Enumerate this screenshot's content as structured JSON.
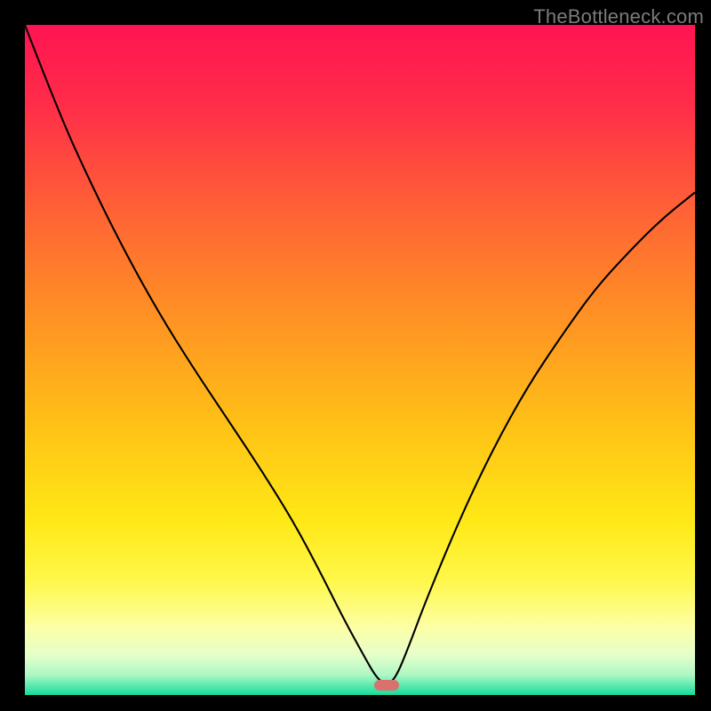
{
  "watermark": "TheBottleneck.com",
  "marker": {
    "x_frac": 0.54,
    "y_frac": 0.985,
    "color": "#d9716f"
  },
  "gradient_stops": [
    {
      "offset": 0.0,
      "color": "#ff1452"
    },
    {
      "offset": 0.12,
      "color": "#ff2d49"
    },
    {
      "offset": 0.28,
      "color": "#ff6335"
    },
    {
      "offset": 0.44,
      "color": "#ff9323"
    },
    {
      "offset": 0.6,
      "color": "#ffc216"
    },
    {
      "offset": 0.74,
      "color": "#ffe816"
    },
    {
      "offset": 0.83,
      "color": "#fff84b"
    },
    {
      "offset": 0.9,
      "color": "#fcffa6"
    },
    {
      "offset": 0.94,
      "color": "#e6ffc9"
    },
    {
      "offset": 0.97,
      "color": "#aef7c4"
    },
    {
      "offset": 0.985,
      "color": "#5feab0"
    },
    {
      "offset": 1.0,
      "color": "#15dc9b"
    }
  ],
  "chart_data": {
    "type": "line",
    "title": "",
    "xlabel": "",
    "ylabel": "",
    "xlim": [
      0,
      1
    ],
    "ylim": [
      0,
      1
    ],
    "grid": false,
    "legend": false,
    "series": [
      {
        "name": "curve",
        "color": "#000000",
        "x": [
          0.0,
          0.05,
          0.1,
          0.15,
          0.2,
          0.25,
          0.3,
          0.35,
          0.4,
          0.44,
          0.475,
          0.505,
          0.525,
          0.54,
          0.553,
          0.57,
          0.6,
          0.65,
          0.7,
          0.75,
          0.8,
          0.85,
          0.9,
          0.95,
          1.0
        ],
        "y": [
          1.0,
          0.87,
          0.76,
          0.66,
          0.57,
          0.49,
          0.415,
          0.34,
          0.26,
          0.185,
          0.115,
          0.06,
          0.025,
          0.015,
          0.025,
          0.065,
          0.145,
          0.265,
          0.37,
          0.46,
          0.535,
          0.605,
          0.66,
          0.71,
          0.75
        ]
      }
    ],
    "annotations": [
      {
        "type": "marker",
        "x": 0.54,
        "y": 0.015,
        "shape": "rounded-bar",
        "color": "#d9716f"
      }
    ]
  }
}
